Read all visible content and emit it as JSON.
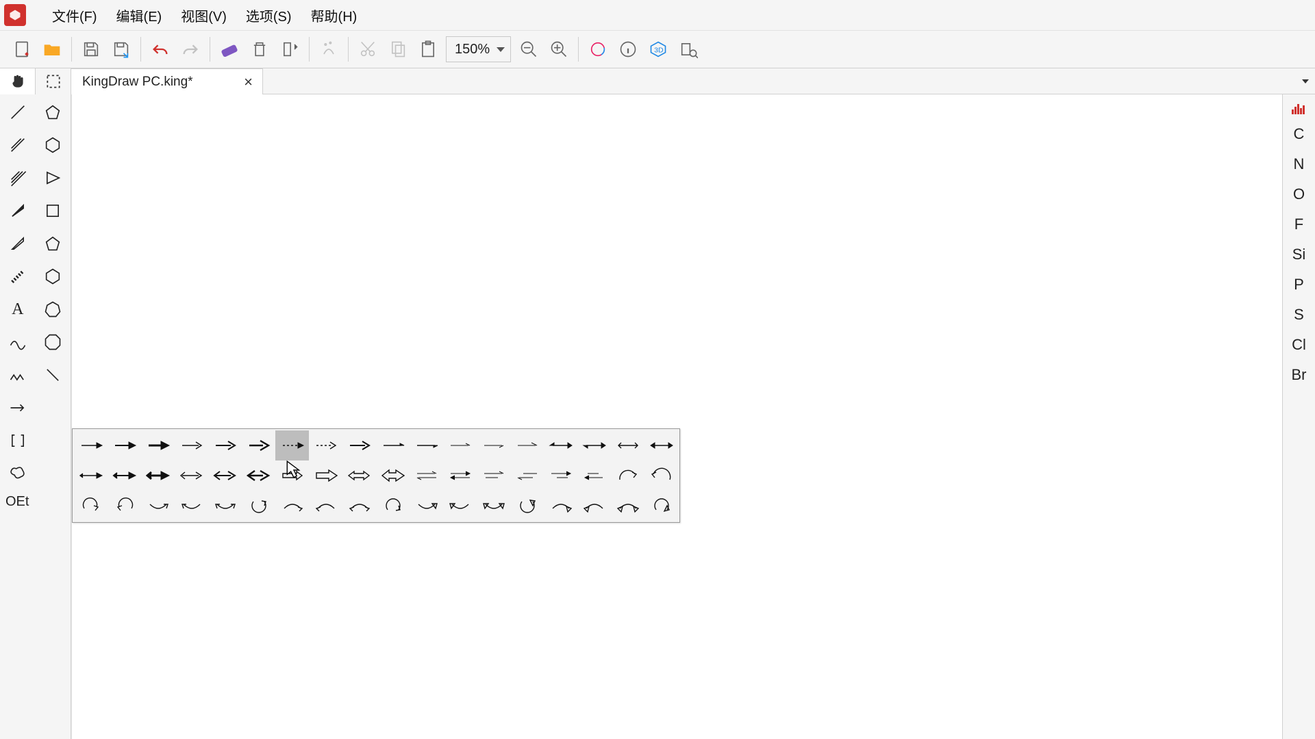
{
  "menu": {
    "file": "文件(F)",
    "edit": "编辑(E)",
    "view": "视图(V)",
    "options": "选项(S)",
    "help": "帮助(H)"
  },
  "toolbar": {
    "zoom": "150%"
  },
  "tab": {
    "title": "KingDraw PC.king*"
  },
  "left": {
    "oet": "OEt"
  },
  "elements": [
    "C",
    "N",
    "O",
    "F",
    "Si",
    "P",
    "S",
    "Cl",
    "Br"
  ]
}
